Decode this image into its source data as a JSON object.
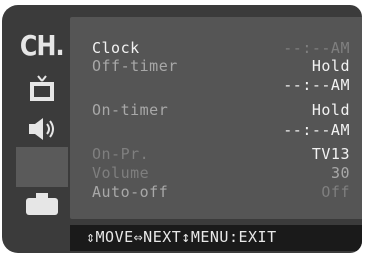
{
  "sidebar": {
    "ch_label": "CH.",
    "icons": [
      "tv-icon",
      "speaker-icon",
      "settings-icon",
      "briefcase-icon"
    ]
  },
  "menu": {
    "clock_label": "Clock",
    "clock_value": "--:--AM",
    "off_timer_label": "Off-timer",
    "off_timer_value": "Hold",
    "off_timer_time": "--:--AM",
    "on_timer_label": "On-timer",
    "on_timer_value": "Hold",
    "on_timer_time": "--:--AM",
    "on_pr_label": "On-Pr.",
    "on_pr_value": "TV13",
    "volume_label": "Volume",
    "volume_value": "30",
    "auto_off_label": "Auto-off",
    "auto_off_value": "Off"
  },
  "footer": {
    "hint": "⇕MOVE⇔NEXT↕MENU:EXIT"
  },
  "colors": {
    "screen_bg": "#3b3b3b",
    "panel_bg": "#555555",
    "footer_bg": "#1a1a1a",
    "text_bright": "#f2f2f2",
    "text_dim": "#a8a8a8"
  }
}
